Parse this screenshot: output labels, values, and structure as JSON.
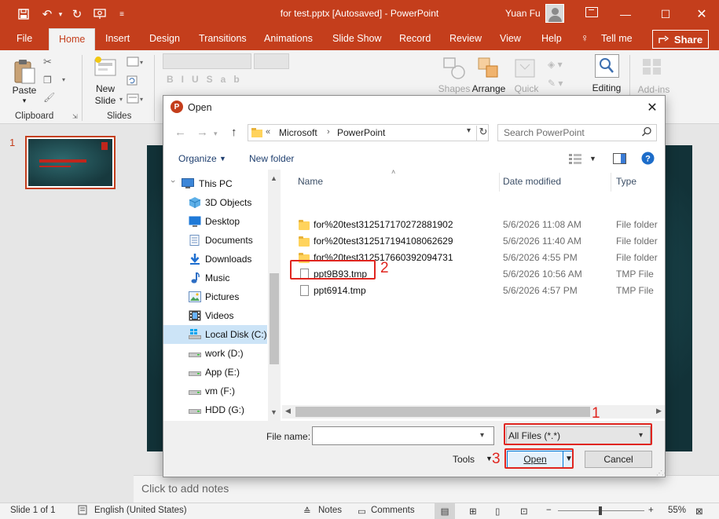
{
  "app": {
    "window_title": "for test.pptx [Autosaved]  -  PowerPoint",
    "user_name": "Yuan Fu",
    "accent": "#c43e1c"
  },
  "quick_access": {
    "save_icon": "save-icon",
    "undo_icon": "undo-icon",
    "redo_icon": "redo-icon",
    "present_icon": "present-icon",
    "customize_icon": "customize-icon"
  },
  "tabs": [
    {
      "label": "File"
    },
    {
      "label": "Home",
      "active": true
    },
    {
      "label": "Insert"
    },
    {
      "label": "Design"
    },
    {
      "label": "Transitions"
    },
    {
      "label": "Animations"
    },
    {
      "label": "Slide Show"
    },
    {
      "label": "Record"
    },
    {
      "label": "Review"
    },
    {
      "label": "View"
    },
    {
      "label": "Help"
    },
    {
      "label": "Tell me"
    }
  ],
  "share_label": "Share",
  "ribbon": {
    "paste_label": "Paste",
    "new_slide_label": "New\nSlide",
    "clipboard_label": "Clipboard",
    "slides_label": "Slides",
    "shapes_label": "Shapes",
    "arrange_label": "Arrange",
    "quick_label": "Quick",
    "editing_label": "Editing",
    "addins_label": "Add-ins"
  },
  "slide_pane": {
    "slide_number": "1"
  },
  "notes_placeholder": "Click to add notes",
  "status_bar": {
    "slide_info": "Slide 1 of 1",
    "language": "English (United States)",
    "notes_label": "Notes",
    "comments_label": "Comments",
    "zoom": "55%"
  },
  "dialog": {
    "title": "Open",
    "address": {
      "prefix": "«",
      "segments": [
        "Microsoft",
        "PowerPoint"
      ]
    },
    "search_placeholder": "Search PowerPoint",
    "organize_label": "Organize",
    "new_folder_label": "New folder",
    "nav_items": [
      {
        "label": "This PC",
        "icon": "pc-icon"
      },
      {
        "label": "3D Objects",
        "icon": "cube-icon"
      },
      {
        "label": "Desktop",
        "icon": "desktop-icon"
      },
      {
        "label": "Documents",
        "icon": "documents-icon"
      },
      {
        "label": "Downloads",
        "icon": "download-icon"
      },
      {
        "label": "Music",
        "icon": "music-icon"
      },
      {
        "label": "Pictures",
        "icon": "pictures-icon"
      },
      {
        "label": "Videos",
        "icon": "videos-icon"
      },
      {
        "label": "Local Disk (C:)",
        "icon": "disk-icon",
        "selected": true
      },
      {
        "label": "work (D:)",
        "icon": "drive-icon"
      },
      {
        "label": "App (E:)",
        "icon": "drive-icon"
      },
      {
        "label": "vm (F:)",
        "icon": "drive-icon"
      },
      {
        "label": "HDD (G:)",
        "icon": "drive-icon"
      }
    ],
    "columns": {
      "name": "Name",
      "date": "Date modified",
      "type": "Type"
    },
    "files": [
      {
        "name": "for%20test312517170272881902",
        "date": "5/6/2026 11:08 AM",
        "type": "File folder",
        "kind": "folder"
      },
      {
        "name": "for%20test312517194108062629",
        "date": "5/6/2026 11:40 AM",
        "type": "File folder",
        "kind": "folder"
      },
      {
        "name": "for%20test312517660392094731",
        "date": "5/6/2026 4:55 PM",
        "type": "File folder",
        "kind": "folder"
      },
      {
        "name": "ppt9B93.tmp",
        "date": "5/6/2026 10:56 AM",
        "type": "TMP File",
        "kind": "file"
      },
      {
        "name": "ppt6914.tmp",
        "date": "5/6/2026 4:57 PM",
        "type": "TMP File",
        "kind": "file"
      }
    ],
    "file_name_label": "File name:",
    "file_name_value": "",
    "filter_value": "All Files (*.*)",
    "tools_label": "Tools",
    "open_label": "Open",
    "cancel_label": "Cancel"
  },
  "annotations": {
    "step1": "1",
    "step2": "2",
    "step3": "3",
    "color": "#e0251f"
  }
}
